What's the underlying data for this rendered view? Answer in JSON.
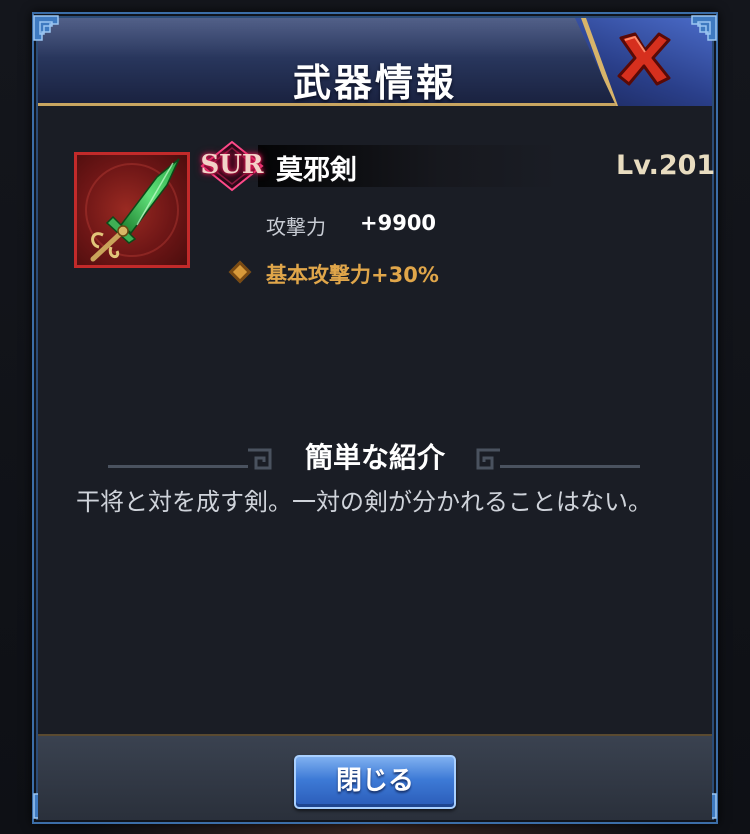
{
  "dialog": {
    "title": "武器情報",
    "close_icon": "close-x-icon"
  },
  "weapon": {
    "icon": "green-jade-sword-icon",
    "rarity": "SUR",
    "name": "莫邪剣",
    "level": "Lv.201",
    "stat_label": "攻撃力",
    "stat_value": "+9900",
    "bonus_icon": "diamond-bullet-icon",
    "bonus": "基本攻撃力+30%"
  },
  "intro": {
    "heading": "簡単な紹介",
    "text": "干将と対を成す剣。一対の剣が分かれることはない。"
  },
  "footer": {
    "close_label": "閉じる"
  },
  "colors": {
    "frame_blue": "#3c6ea8",
    "gold_accent": "#c8a560",
    "bonus_orange": "#e0a64a",
    "close_red": "#d6301e",
    "button_blue": "#3d7ad6"
  }
}
